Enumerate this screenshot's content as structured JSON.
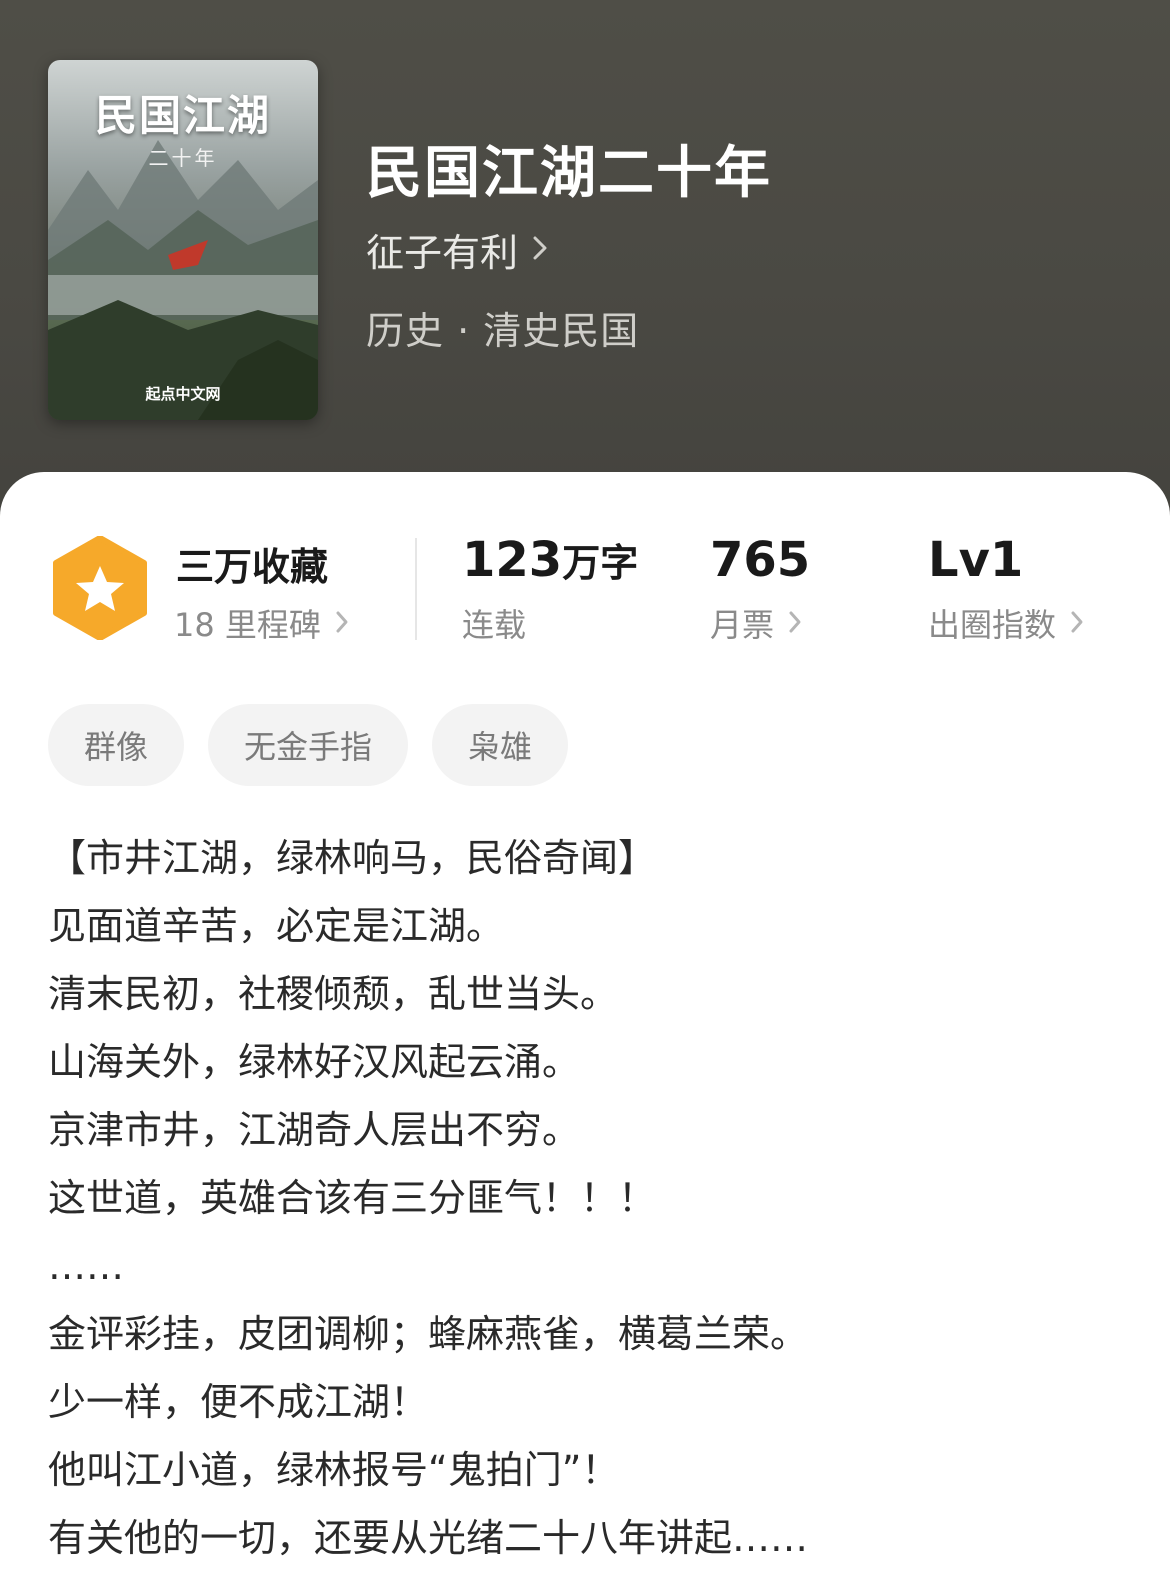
{
  "book": {
    "title": "民国江湖二十年",
    "author": "征子有利",
    "category": "历史 · 清史民国",
    "cover": {
      "title": "民国江湖",
      "subtitle": "二十年",
      "publisher": "起点中文网"
    }
  },
  "stats": {
    "favorites": {
      "main": "三万收藏",
      "sub": "18 里程碑"
    },
    "words": {
      "value": "123",
      "unit": "万字",
      "sub": "连载"
    },
    "monthly_tickets": {
      "main": "765",
      "sub": "月票"
    },
    "popularity": {
      "main": "Lv1",
      "sub": "出圈指数"
    }
  },
  "tags": [
    "群像",
    "无金手指",
    "枭雄"
  ],
  "synopsis": [
    "【市井江湖，绿林响马，民俗奇闻】",
    "见面道辛苦，必定是江湖。",
    "清末民初，社稷倾颓，乱世当头。",
    "山海关外，绿林好汉风起云涌。",
    "京津市井，江湖奇人层出不穷。",
    "这世道，英雄合该有三分匪气！！！",
    "……",
    "金评彩挂，皮团调柳；蜂麻燕雀，横葛兰荣。",
    "少一样，便不成江湖！",
    "他叫江小道，绿林报号“鬼拍门”！",
    "有关他的一切，还要从光绪二十八年讲起……"
  ],
  "colors": {
    "header_bg": "#4a4943",
    "badge_orange": "#f5a623",
    "text_primary": "#1a1a1a",
    "text_secondary": "#8a8a8a"
  }
}
